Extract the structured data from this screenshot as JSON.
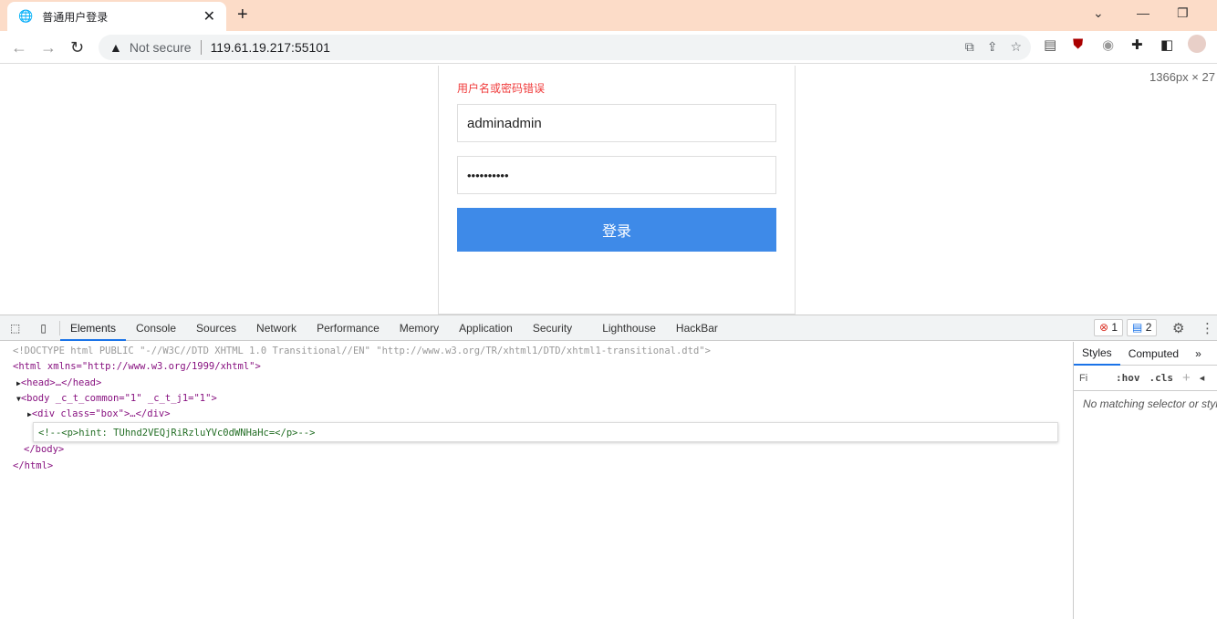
{
  "browser": {
    "tab_title": "普通用户登录",
    "url_security": "Not secure",
    "url": "119.61.19.217:55101",
    "viewport_size": "1366px × 27"
  },
  "login": {
    "error": "用户名或密码错误",
    "username": "adminadmin",
    "password": "••••••••••",
    "submit": "登录"
  },
  "devtools": {
    "tabs": [
      "Elements",
      "Console",
      "Sources",
      "Network",
      "Performance",
      "Memory",
      "Application",
      "Security",
      "Lighthouse",
      "HackBar"
    ],
    "errors": "1",
    "messages": "2",
    "code": {
      "doctype": "<!DOCTYPE html PUBLIC \"-//W3C//DTD XHTML 1.0 Transitional//EN\" \"http://www.w3.org/TR/xhtml1/DTD/xhtml1-transitional.dtd\">",
      "html_open": "<html xmlns=\"http://www.w3.org/1999/xhtml\">",
      "head": "<head>…</head>",
      "body_open": "<body _c_t_common=\"1\" _c_t_j1=\"1\">",
      "div": "<div class=\"box\">…</div>",
      "comment": "<!--<p>hint: TUhnd2VEQjRiRzluYVc0dWNHaHc=</p>-->",
      "body_close": "</body>",
      "html_close": "</html>"
    },
    "styles_tabs": [
      "Styles",
      "Computed"
    ],
    "filter_placeholder": "Fi",
    "hov": ":hov",
    "cls": ".cls",
    "no_match": "No matching selector or style"
  }
}
